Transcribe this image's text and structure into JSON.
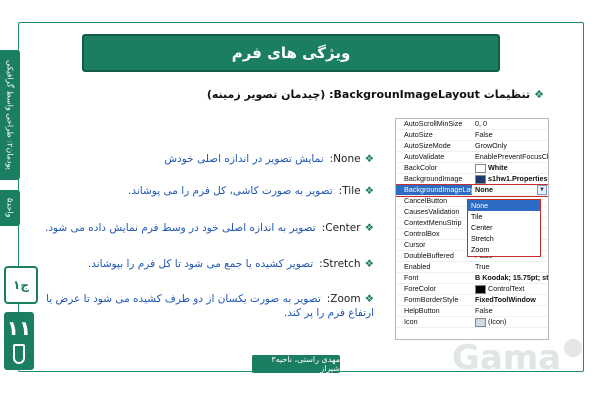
{
  "slide": {
    "title": "ویژگی های فرم",
    "subtitle": "تنظیمات BackgrounImageLayout: (چیدمان تصویر زمینه)",
    "lesson_tab": "پودمان۲: طراحی واسط گرافیکی",
    "unit_tab": "واحد۵",
    "chapter_badge": "ج۱",
    "page_number": "۱۱",
    "footer_text": "مهدی راستی، ناحیه۳ شیراز",
    "watermark": "Gama"
  },
  "layouts": [
    {
      "tag": "None:",
      "desc": "نمایش تصویر در اندازه اصلی خودش"
    },
    {
      "tag": "Tile:",
      "desc": "تصویر به صورت کاشی، کل فرم را می پوشاند."
    },
    {
      "tag": "Center:",
      "desc": "تصویر به اندازه اصلی خود در وسط فرم نمایش داده می شود."
    },
    {
      "tag": "Stretch:",
      "desc": "تصویر کشیده یا جمع می شود تا کل فرم را بپوشاند."
    },
    {
      "tag": "Zoom:",
      "desc": "تصویر به صورت یکسان از دو طرف کشیده می شود تا عرض یا ارتفاع فرم را پر کند."
    }
  ],
  "properties": [
    {
      "name": "AutoScrollMinSize",
      "value": "0, 0"
    },
    {
      "name": "AutoSize",
      "value": "False"
    },
    {
      "name": "AutoSizeMode",
      "value": "GrowOnly"
    },
    {
      "name": "AutoValidate",
      "value": "EnablePreventFocusChange"
    },
    {
      "name": "BackColor",
      "value": "White"
    },
    {
      "name": "BackgroundImage",
      "value": "s1hw1.Properties.Res"
    },
    {
      "name": "BackgroundImageLayout",
      "value": "None"
    },
    {
      "name": "CancelButton",
      "value": ""
    },
    {
      "name": "CausesValidation",
      "value": ""
    },
    {
      "name": "ContextMenuStrip",
      "value": ""
    },
    {
      "name": "ControlBox",
      "value": ""
    },
    {
      "name": "Cursor",
      "value": ""
    },
    {
      "name": "DoubleBuffered",
      "value": "False"
    },
    {
      "name": "Enabled",
      "value": "True"
    },
    {
      "name": "Font",
      "value": "B Koodak; 15.75pt; style=E"
    },
    {
      "name": "ForeColor",
      "value": "ControlText"
    },
    {
      "name": "FormBorderStyle",
      "value": "FixedToolWindow"
    },
    {
      "name": "HelpButton",
      "value": "False"
    },
    {
      "name": "Icon",
      "value": "(Icon)"
    }
  ],
  "dropdown_options": [
    "None",
    "Tile",
    "Center",
    "Stretch",
    "Zoom"
  ],
  "colors": {
    "accent": "#1b7d62",
    "selection": "#2c6cc4",
    "highlight_border": "#c62d2d",
    "desc_text": "#1f56b5"
  }
}
